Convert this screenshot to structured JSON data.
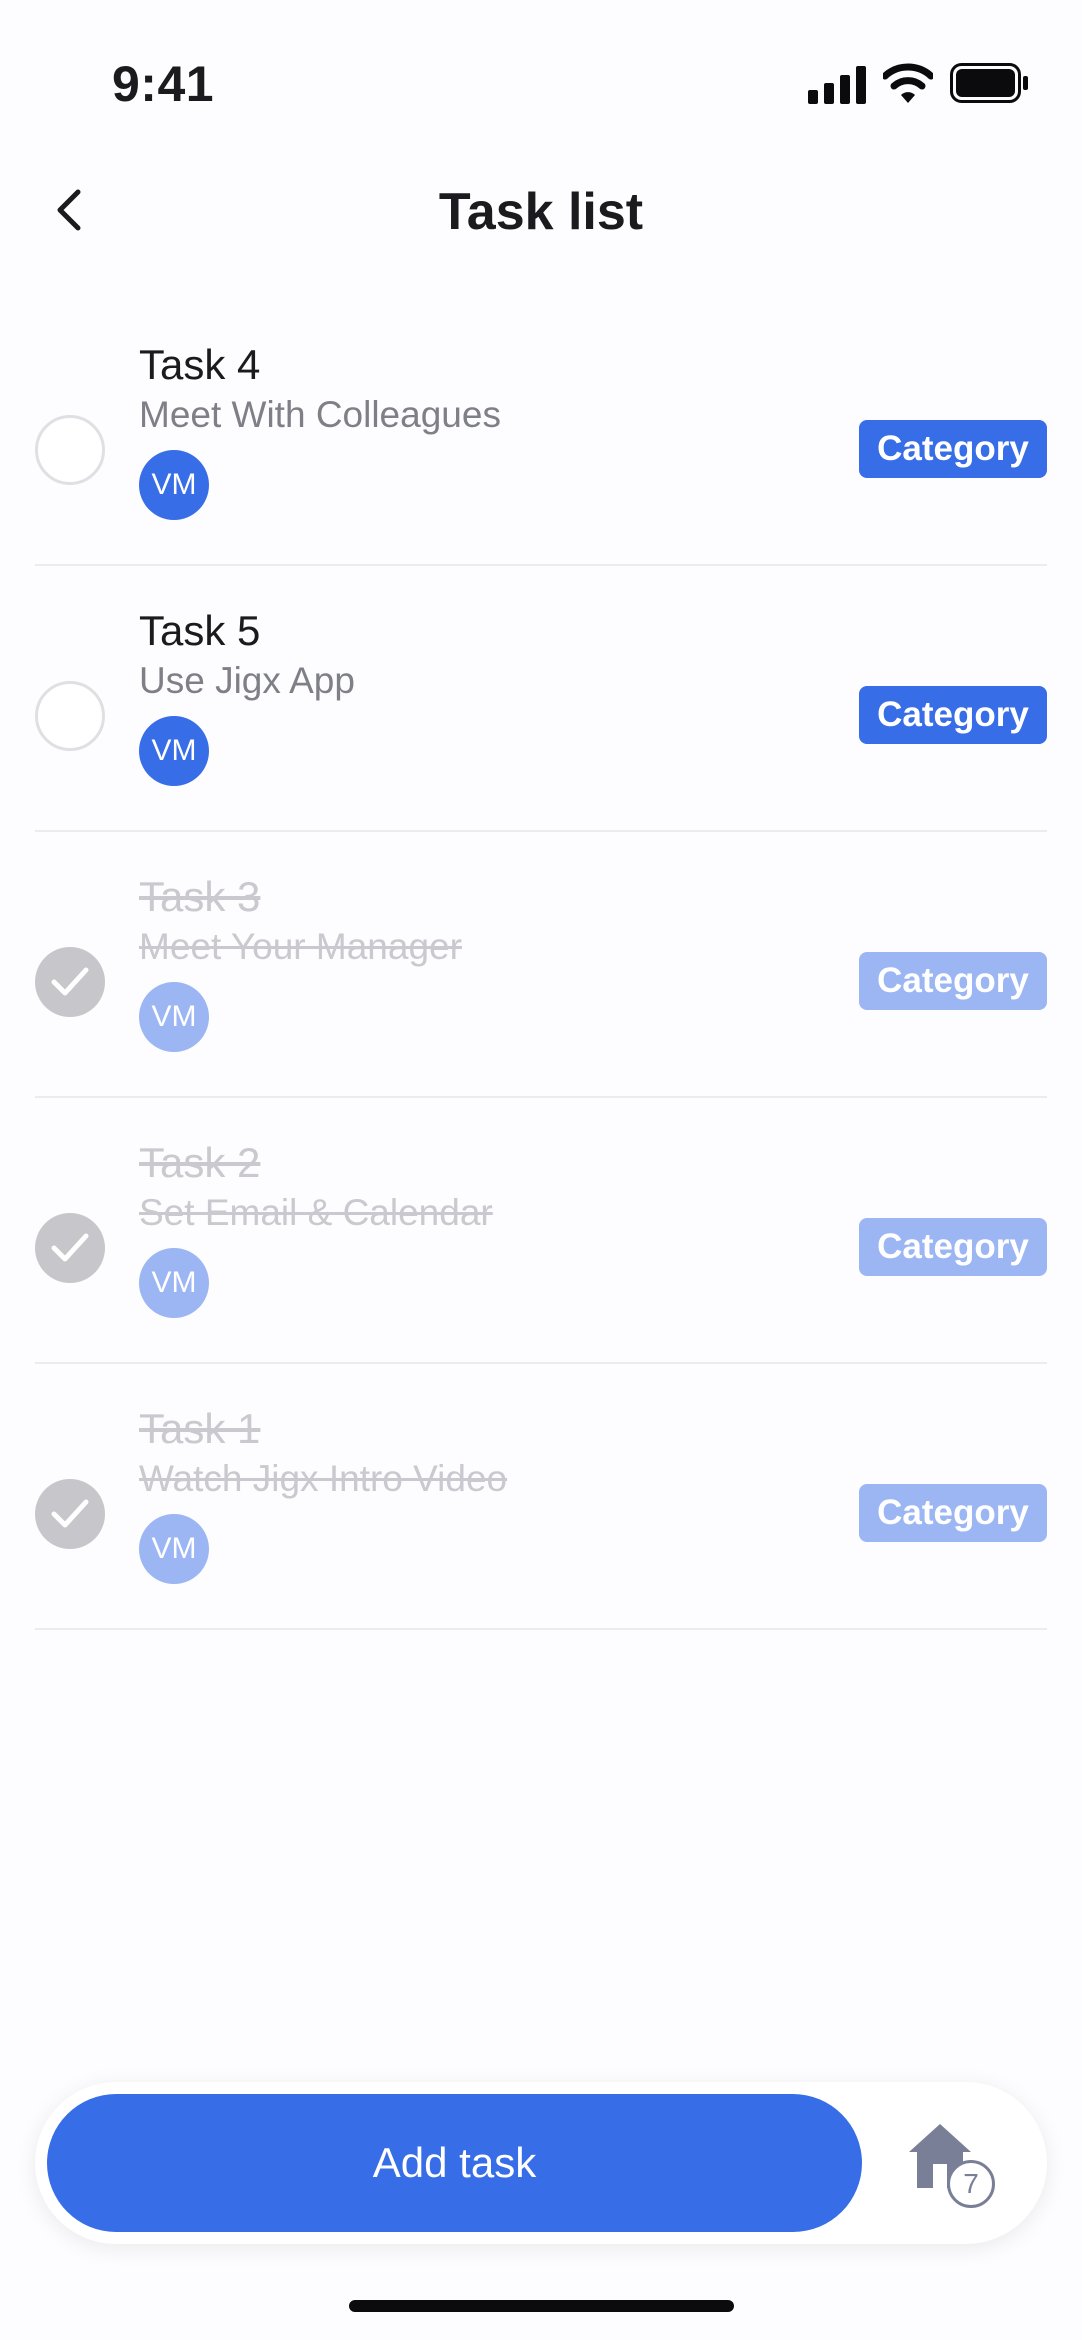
{
  "status_bar": {
    "time": "9:41"
  },
  "header": {
    "title": "Task list"
  },
  "tasks": [
    {
      "title": "Task 4",
      "subtitle": "Meet With Colleagues",
      "assignee_initials": "VM",
      "category": "Category",
      "completed": false
    },
    {
      "title": "Task 5",
      "subtitle": "Use Jigx App",
      "assignee_initials": "VM",
      "category": "Category",
      "completed": false
    },
    {
      "title": "Task 3",
      "subtitle": "Meet Your Manager",
      "assignee_initials": "VM",
      "category": "Category",
      "completed": true
    },
    {
      "title": "Task 2",
      "subtitle": "Set Email & Calendar",
      "assignee_initials": "VM",
      "category": "Category",
      "completed": true
    },
    {
      "title": "Task 1",
      "subtitle": "Watch Jigx Intro Video",
      "assignee_initials": "VM",
      "category": "Category",
      "completed": true
    }
  ],
  "bottom_bar": {
    "add_task_label": "Add task",
    "home_badge_count": "7"
  },
  "colors": {
    "accent": "#386de8",
    "accent_faded": "#9cb6f3",
    "check_done": "#c6c6cb"
  }
}
